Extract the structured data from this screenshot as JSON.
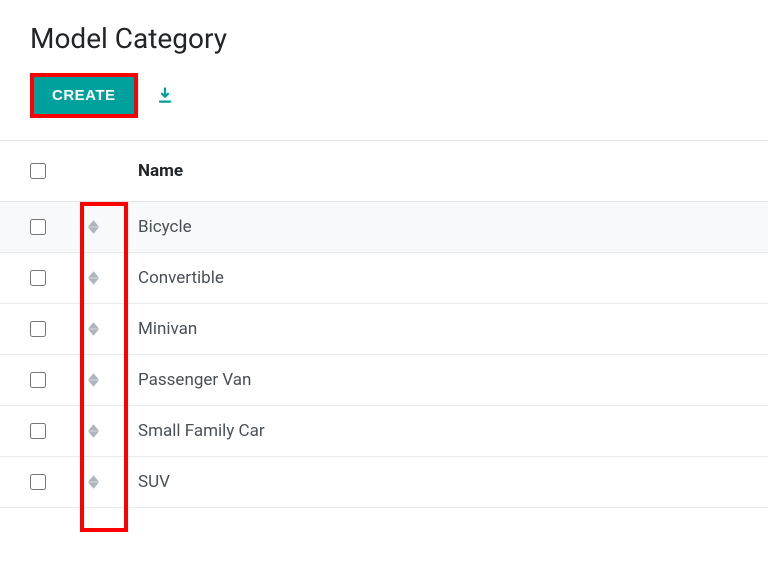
{
  "header": {
    "title": "Model Category",
    "create_label": "CREATE"
  },
  "table": {
    "columns": {
      "name": "Name"
    },
    "rows": [
      {
        "name": "Bicycle"
      },
      {
        "name": "Convertible"
      },
      {
        "name": "Minivan"
      },
      {
        "name": "Passenger Van"
      },
      {
        "name": "Small Family Car"
      },
      {
        "name": "SUV"
      }
    ]
  }
}
